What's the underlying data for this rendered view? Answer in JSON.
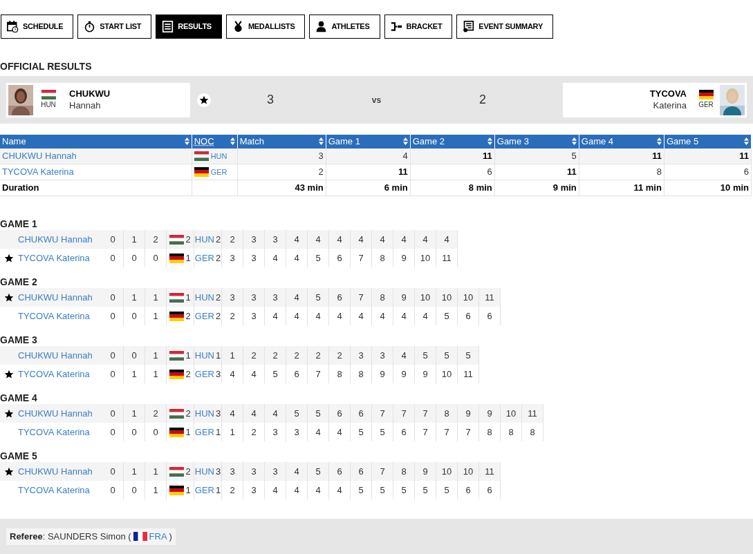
{
  "nav": [
    {
      "label": "SCHEDULE",
      "selected": false
    },
    {
      "label": "START LIST",
      "selected": false
    },
    {
      "label": "RESULTS",
      "selected": true
    },
    {
      "label": "MEDALLISTS",
      "selected": false
    },
    {
      "label": "ATHLETES",
      "selected": false
    },
    {
      "label": "BRACKET",
      "selected": false
    },
    {
      "label": "EVENT SUMMARY",
      "selected": false
    }
  ],
  "section_title": "OFFICIAL RESULTS",
  "match": {
    "home": {
      "surname": "CHUKWU",
      "given": "Hannah",
      "noc": "HUN",
      "score": "3",
      "star": true
    },
    "vs": "vs",
    "away": {
      "surname": "TYCOVA",
      "given": "Katerina",
      "noc": "GER",
      "score": "2",
      "star": false
    }
  },
  "table": {
    "columns": [
      "Name",
      "NOC",
      "Match",
      "Game 1",
      "Game 2",
      "Game 3",
      "Game 4",
      "Game 5"
    ],
    "rows": [
      {
        "cells": [
          {
            "text": "CHUKWU Hannah",
            "bold": false
          },
          {
            "text": "HUN",
            "bold": false
          },
          {
            "text": "3",
            "bold": false
          },
          {
            "text": "4",
            "bold": false
          },
          {
            "text": "11",
            "bold": true
          },
          {
            "text": "5",
            "bold": false
          },
          {
            "text": "11",
            "bold": true
          },
          {
            "text": "11",
            "bold": true
          }
        ]
      },
      {
        "cells": [
          {
            "text": "TYCOVA Katerina",
            "bold": false
          },
          {
            "text": "GER",
            "bold": false
          },
          {
            "text": "2",
            "bold": false
          },
          {
            "text": "11",
            "bold": true
          },
          {
            "text": "6",
            "bold": false
          },
          {
            "text": "11",
            "bold": true
          },
          {
            "text": "8",
            "bold": false
          },
          {
            "text": "6",
            "bold": false
          }
        ]
      },
      {
        "cells": [
          {
            "text": "Duration",
            "bold": true
          },
          {
            "text": ""
          },
          {
            "text": "43 min",
            "bold": true
          },
          {
            "text": "6 min",
            "bold": true
          },
          {
            "text": "8 min",
            "bold": true
          },
          {
            "text": "9 min",
            "bold": true
          },
          {
            "text": "11 min",
            "bold": true
          },
          {
            "text": "10 min",
            "bold": true
          }
        ]
      }
    ]
  },
  "games": [
    {
      "title": "GAME 1",
      "rows": [
        {
          "name": "CHUKWU Hannah",
          "star": false,
          "noc": "HUN",
          "scores": [
            "0",
            "1",
            "2",
            "2",
            "2",
            "2",
            "3",
            "3",
            "4",
            "4",
            "4",
            "4",
            "4",
            "4",
            "4",
            "4"
          ]
        },
        {
          "name": "TYCOVA Katerina",
          "star": true,
          "noc": "GER",
          "scores": [
            "0",
            "0",
            "0",
            "1",
            "2",
            "3",
            "3",
            "4",
            "4",
            "5",
            "6",
            "7",
            "8",
            "9",
            "10",
            "11"
          ]
        }
      ]
    },
    {
      "title": "GAME 2",
      "rows": [
        {
          "name": "CHUKWU Hannah",
          "star": true,
          "noc": "HUN",
          "scores": [
            "0",
            "1",
            "1",
            "1",
            "2",
            "3",
            "3",
            "3",
            "4",
            "5",
            "6",
            "7",
            "8",
            "9",
            "10",
            "10",
            "10",
            "11"
          ]
        },
        {
          "name": "TYCOVA Katerina",
          "star": false,
          "noc": "GER",
          "scores": [
            "0",
            "0",
            "1",
            "2",
            "2",
            "2",
            "3",
            "4",
            "4",
            "4",
            "4",
            "4",
            "4",
            "4",
            "4",
            "5",
            "6",
            "6"
          ]
        }
      ]
    },
    {
      "title": "GAME 3",
      "rows": [
        {
          "name": "CHUKWU Hannah",
          "star": false,
          "noc": "HUN",
          "scores": [
            "0",
            "0",
            "1",
            "1",
            "1",
            "1",
            "2",
            "2",
            "2",
            "2",
            "2",
            "3",
            "3",
            "4",
            "5",
            "5",
            "5"
          ]
        },
        {
          "name": "TYCOVA Katerina",
          "star": true,
          "noc": "GER",
          "scores": [
            "0",
            "1",
            "1",
            "2",
            "3",
            "4",
            "4",
            "5",
            "6",
            "7",
            "8",
            "8",
            "9",
            "9",
            "9",
            "10",
            "11"
          ]
        }
      ]
    },
    {
      "title": "GAME 4",
      "rows": [
        {
          "name": "CHUKWU Hannah",
          "star": true,
          "noc": "HUN",
          "scores": [
            "0",
            "1",
            "2",
            "2",
            "3",
            "4",
            "4",
            "4",
            "5",
            "5",
            "6",
            "6",
            "7",
            "7",
            "7",
            "8",
            "9",
            "9",
            "10",
            "11"
          ]
        },
        {
          "name": "TYCOVA Katerina",
          "star": false,
          "noc": "GER",
          "scores": [
            "0",
            "0",
            "0",
            "1",
            "1",
            "1",
            "2",
            "3",
            "3",
            "4",
            "4",
            "5",
            "5",
            "6",
            "7",
            "7",
            "7",
            "8",
            "8",
            "8"
          ]
        }
      ]
    },
    {
      "title": "GAME 5",
      "rows": [
        {
          "name": "CHUKWU Hannah",
          "star": true,
          "noc": "HUN",
          "scores": [
            "0",
            "1",
            "1",
            "2",
            "3",
            "3",
            "3",
            "3",
            "4",
            "5",
            "6",
            "6",
            "7",
            "8",
            "9",
            "10",
            "10",
            "11"
          ]
        },
        {
          "name": "TYCOVA Katerina",
          "star": false,
          "noc": "GER",
          "scores": [
            "0",
            "0",
            "1",
            "1",
            "1",
            "2",
            "3",
            "4",
            "4",
            "4",
            "4",
            "5",
            "5",
            "5",
            "5",
            "5",
            "6",
            "6"
          ]
        }
      ]
    }
  ],
  "referee": {
    "label": "Referee",
    "text": ": SAUNDERS Simon (",
    "noc": "FRA",
    "close": ")"
  }
}
